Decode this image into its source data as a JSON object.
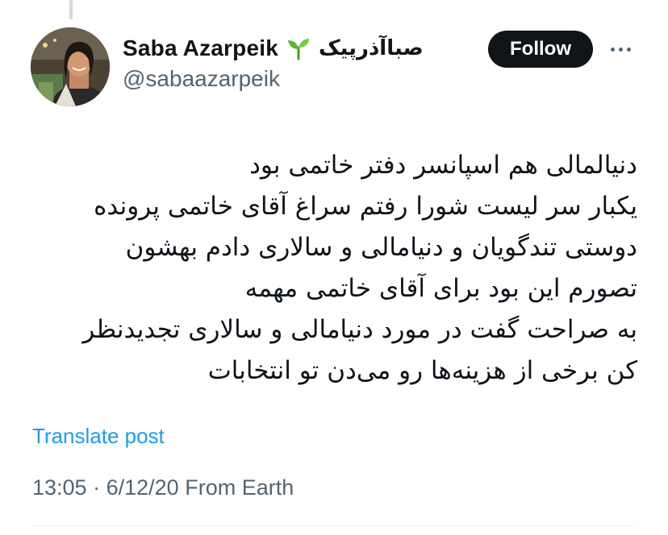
{
  "author": {
    "display_name": "Saba Azarpeik",
    "display_name_fa": "صباآذرپیک",
    "emoji_icon": "sprout-icon",
    "handle": "@sabaazarpeik"
  },
  "follow_label": "Follow",
  "more_icon": "more-horizontal-icon",
  "tweet": {
    "lines": [
      "دنیالمالی هم اسپانسر دفتر خاتمی بود",
      "یکبار سر لیست شورا رفتم سراغ آقای خاتمی پرونده",
      "دوستی تندگویان و دنیامالی و سالاری دادم بهشون",
      "تصورم این بود برای آقای خاتمی مهمه",
      "به صراحت گفت در مورد دنیامالی و سالاری تجدیدنظر",
      "کن برخی از هزینه‌ها رو می‌دن تو انتخابات"
    ]
  },
  "translate_label": "Translate post",
  "meta": {
    "time": "13:05",
    "separator": "·",
    "date": "6/12/20",
    "source": "From Earth"
  },
  "colors": {
    "link": "#1d9bf0",
    "secondary_text": "#536471",
    "follow_bg": "#0f1419"
  }
}
